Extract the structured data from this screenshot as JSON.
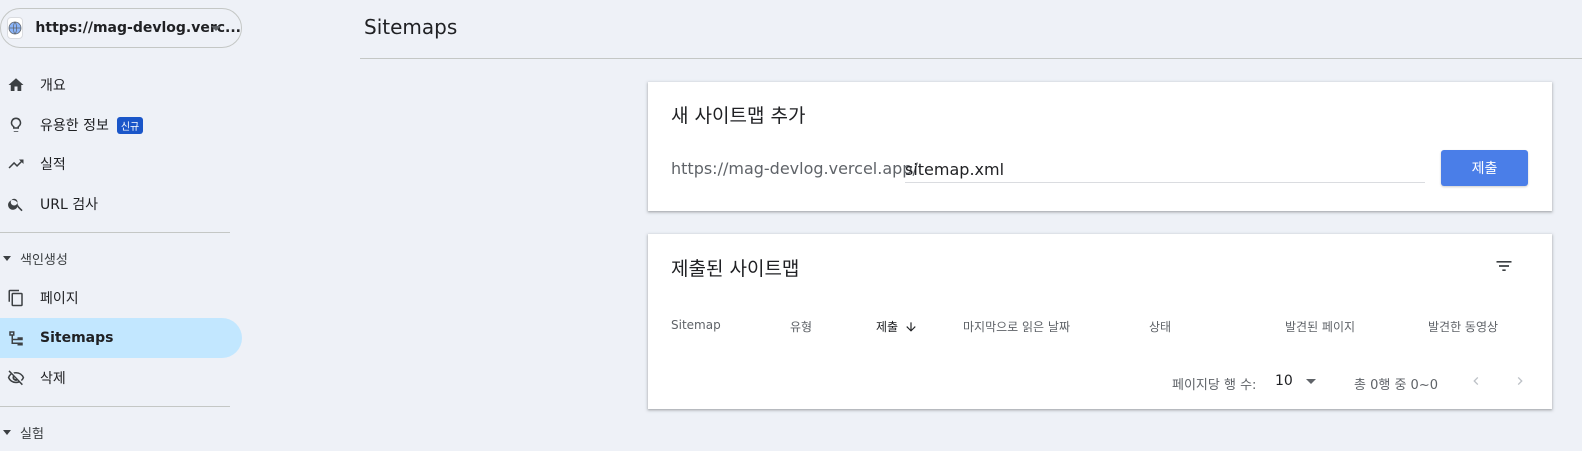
{
  "property": {
    "url": "https://mag-devlog.verc..."
  },
  "sidebar": {
    "items": [
      {
        "label": "개요",
        "icon": "home-icon"
      },
      {
        "label": "유용한 정보",
        "icon": "lightbulb-icon",
        "badge": "신규"
      },
      {
        "label": "실적",
        "icon": "trending-up-icon"
      },
      {
        "label": "URL 검사",
        "icon": "search-icon"
      }
    ],
    "indexing_section": "색인생성",
    "indexing_items": [
      {
        "label": "페이지",
        "icon": "pages-icon"
      },
      {
        "label": "Sitemaps",
        "icon": "sitemap-icon",
        "active": true
      },
      {
        "label": "삭제",
        "icon": "visibility-off-icon"
      }
    ],
    "experiment_section": "실험"
  },
  "header": {
    "title": "Sitemaps"
  },
  "add_sitemap": {
    "title": "새 사이트맵 추가",
    "prefix": "https://mag-devlog.vercel.app/",
    "input_value": "sitemap.xml",
    "submit_label": "제출"
  },
  "submitted": {
    "title": "제출된 사이트맵",
    "columns": [
      "Sitemap",
      "유형",
      "제출",
      "마지막으로 읽은 날짜",
      "상태",
      "발견된 페이지",
      "발견한 동영상"
    ],
    "rows_per_page_label": "페이지당 행 수:",
    "rows_per_page_value": "10",
    "range_text": "총 0행 중 0~0"
  },
  "colors": {
    "accent": "#4a7ee8",
    "active_nav": "#c2e7ff",
    "badge": "#1a56c9"
  }
}
